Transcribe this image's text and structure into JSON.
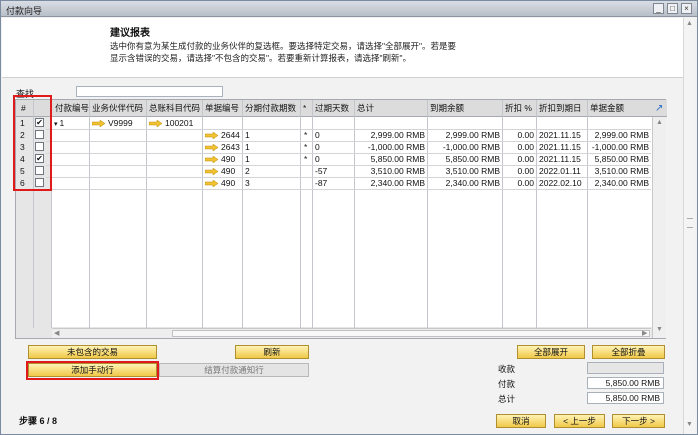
{
  "window": {
    "title": "付款向导"
  },
  "header": {
    "title": "建议报表",
    "desc_line1": "选中你有意为某生成付款的业务伙伴的复选框。要选择特定交易，请选择\"全部展开\"。若是要",
    "desc_line2": "显示含错误的交易，请选择\"不包含的交易\"。若要重新计算报表，请选择\"刷新\"。"
  },
  "find": {
    "label": "查找",
    "value": ""
  },
  "grid": {
    "columns": [
      "#",
      "",
      "付款编号",
      "业务伙伴代码",
      "总账科目代码",
      "单据编号",
      "分期付款期数",
      "*",
      "过期天数",
      "总计",
      "到期余额",
      "折扣 %",
      "折扣到期日",
      "单据金额"
    ],
    "rows": [
      {
        "num": "1",
        "checked": true,
        "pay_no": "1",
        "bp": "V9999",
        "gl": "100201",
        "doc": "",
        "inst": "",
        "star": "",
        "days": "",
        "total": "",
        "balance": "",
        "disc": "",
        "disc_date": "",
        "amount": ""
      },
      {
        "num": "2",
        "checked": false,
        "pay_no": "",
        "bp": "",
        "gl": "",
        "doc": "2644",
        "inst": "1",
        "star": "*",
        "days": "0",
        "total": "2,999.00 RMB",
        "balance": "2,999.00 RMB",
        "disc": "0.00",
        "disc_date": "2021.11.15",
        "amount": "2,999.00 RMB"
      },
      {
        "num": "3",
        "checked": false,
        "pay_no": "",
        "bp": "",
        "gl": "",
        "doc": "2643",
        "inst": "1",
        "star": "*",
        "days": "0",
        "total": "-1,000.00 RMB",
        "balance": "-1,000.00 RMB",
        "disc": "0.00",
        "disc_date": "2021.11.15",
        "amount": "-1,000.00 RMB"
      },
      {
        "num": "4",
        "checked": true,
        "pay_no": "",
        "bp": "",
        "gl": "",
        "doc": "490",
        "inst": "1",
        "star": "*",
        "days": "0",
        "total": "5,850.00 RMB",
        "balance": "5,850.00 RMB",
        "disc": "0.00",
        "disc_date": "2021.11.15",
        "amount": "5,850.00 RMB"
      },
      {
        "num": "5",
        "checked": false,
        "pay_no": "",
        "bp": "",
        "gl": "",
        "doc": "490",
        "inst": "2",
        "star": "",
        "days": "-57",
        "total": "3,510.00 RMB",
        "balance": "3,510.00 RMB",
        "disc": "0.00",
        "disc_date": "2022.01.11",
        "amount": "3,510.00 RMB"
      },
      {
        "num": "6",
        "checked": false,
        "pay_no": "",
        "bp": "",
        "gl": "",
        "doc": "490",
        "inst": "3",
        "star": "",
        "days": "-87",
        "total": "2,340.00 RMB",
        "balance": "2,340.00 RMB",
        "disc": "0.00",
        "disc_date": "2022.02.10",
        "amount": "2,340.00 RMB"
      }
    ]
  },
  "buttons": {
    "excluded": "未包含的交易",
    "refresh": "刷新",
    "expand_all": "全部展开",
    "collapse_all": "全部折叠",
    "add_manual": "添加手动行",
    "settle_notice": "结算付款通知行",
    "cancel": "取消",
    "back": "< 上一步",
    "next": "下一步 >"
  },
  "summary": {
    "receive_label": "收款",
    "receive_value": "",
    "pay_label": "付款",
    "pay_value": "5,850.00 RMB",
    "total_label": "总计",
    "total_value": "5,850.00 RMB"
  },
  "step": "步骤 6 / 8",
  "colors": {
    "button": "#f0c848",
    "highlight": "#e0191b",
    "link_arrow": "#f2c230"
  }
}
